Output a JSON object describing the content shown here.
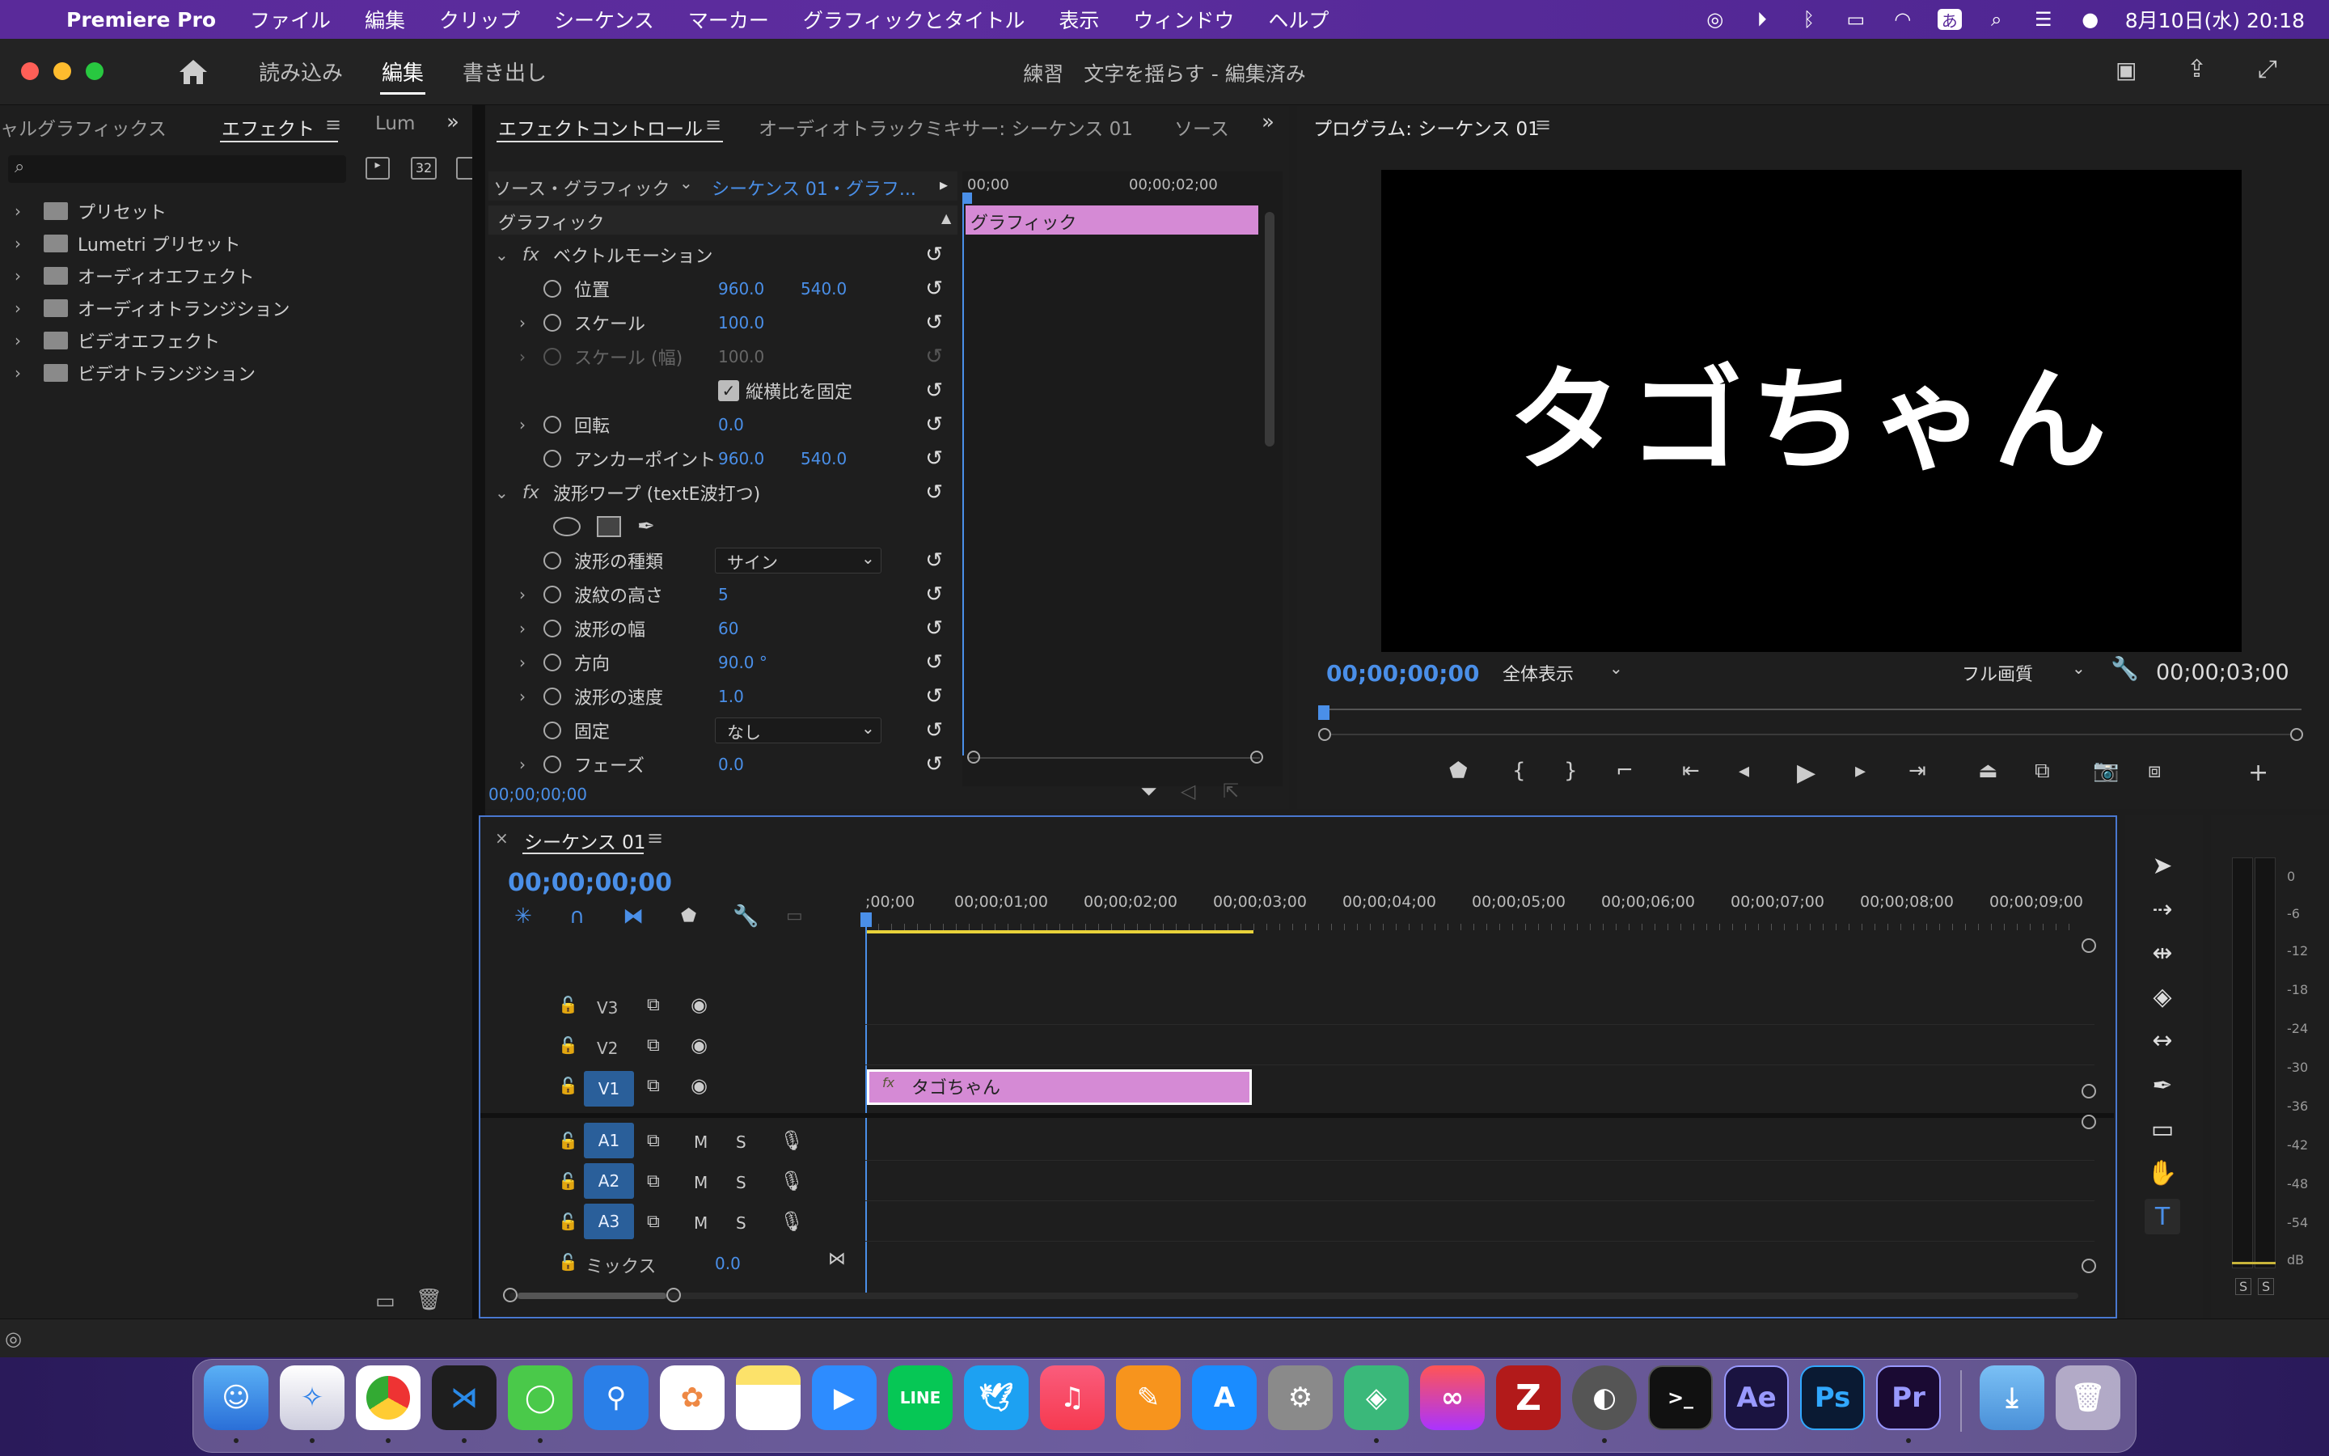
{
  "menubar": {
    "app_name": "Premiere Pro",
    "items": [
      "ファイル",
      "編集",
      "クリップ",
      "シーケンス",
      "マーカー",
      "グラフィックとタイトル",
      "表示",
      "ウィンドウ",
      "ヘルプ"
    ],
    "ime": "あ",
    "clock": "8月10日(水)  20:18"
  },
  "titlebar": {
    "tabs": [
      "読み込み",
      "編集",
      "書き出し"
    ],
    "title": "練習　文字を揺らす - 編集済み"
  },
  "effects_panel": {
    "tabs": [
      "ャルグラフィックス",
      "エフェクト",
      "Lum"
    ],
    "badge_32": "32",
    "tree": [
      "プリセット",
      "Lumetri プリセット",
      "オーディオエフェクト",
      "オーディオトランジション",
      "ビデオエフェクト",
      "ビデオトランジション"
    ]
  },
  "effect_controls": {
    "tabs": [
      "エフェクトコントロール",
      "オーディオトラックミキサー: シーケンス 01",
      "ソース"
    ],
    "source": "ソース・グラフィック",
    "sequence": "シーケンス 01・グラフ...",
    "section": "グラフィック",
    "time_start": "00;00",
    "time_mid": "00;00;02;00",
    "clip_label": "グラフィック",
    "vector_motion": "ベクトルモーション",
    "position": {
      "label": "位置",
      "x": "960.0",
      "y": "540.0"
    },
    "scale": {
      "label": "スケール",
      "value": "100.0"
    },
    "scale_width": {
      "label": "スケール (幅)",
      "value": "100.0"
    },
    "lock_ratio": "縦横比を固定",
    "rotation": {
      "label": "回転",
      "value": "0.0"
    },
    "anchor": {
      "label": "アンカーポイント",
      "x": "960.0",
      "y": "540.0"
    },
    "wave_warp": "波形ワープ (textE波打つ)",
    "wave_type": {
      "label": "波形の種類",
      "value": "サイン"
    },
    "wave_height": {
      "label": "波紋の高さ",
      "value": "5"
    },
    "wave_width": {
      "label": "波形の幅",
      "value": "60"
    },
    "direction": {
      "label": "方向",
      "value": "90.0 °"
    },
    "wave_speed": {
      "label": "波形の速度",
      "value": "1.0"
    },
    "pinning": {
      "label": "固定",
      "value": "なし"
    },
    "phase": {
      "label": "フェーズ",
      "value": "0.0"
    },
    "timecode": "00;00;00;00"
  },
  "program": {
    "title": "プログラム: シーケンス 01",
    "video_text": "タゴちゃん",
    "timecode": "00;00;00;00",
    "zoom": "全体表示",
    "quality": "フル画質",
    "duration": "00;00;03;00"
  },
  "timeline": {
    "title": "シーケンス 01",
    "timecode": "00;00;00;00",
    "ruler": [
      ";00;00",
      "00;00;01;00",
      "00;00;02;00",
      "00;00;03;00",
      "00;00;04;00",
      "00;00;05;00",
      "00;00;06;00",
      "00;00;07;00",
      "00;00;08;00",
      "00;00;09;00"
    ],
    "video_tracks": [
      "V3",
      "V2",
      "V1"
    ],
    "audio_tracks": [
      "A1",
      "A2",
      "A3"
    ],
    "mute": "M",
    "solo": "S",
    "mix_label": "ミックス",
    "mix_value": "0.0",
    "clip_name": "タゴちゃん",
    "fx_badge": "fx"
  },
  "meter": {
    "scale": [
      "0",
      "-6",
      "-12",
      "-18",
      "-24",
      "-30",
      "-36",
      "-42",
      "-48",
      "-54",
      "dB"
    ],
    "solo": [
      "S",
      "S"
    ]
  },
  "dock": {
    "ae": "Ae",
    "ps": "Ps",
    "pr": "Pr",
    "line": "LINE"
  },
  "colors": {
    "menubar": "#5a2a9a",
    "accent_blue": "#4a8fe8",
    "clip_pink": "#d58ad5",
    "timeline_border": "#4a78d0"
  }
}
